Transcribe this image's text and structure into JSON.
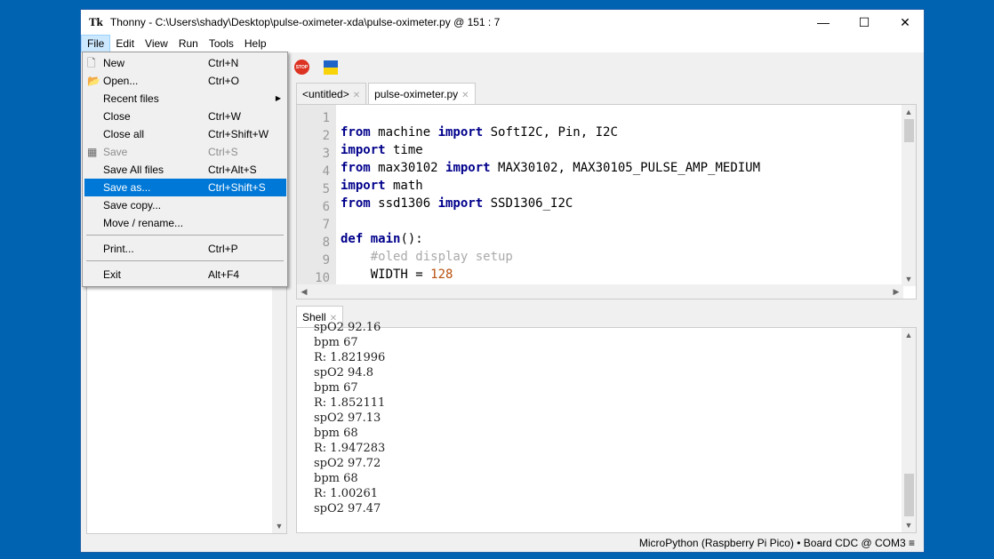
{
  "window": {
    "app_logo": "Tk",
    "title": "Thonny  -  C:\\Users\\shady\\Desktop\\pulse-oximeter-xda\\pulse-oximeter.py  @  151 : 7",
    "minimize": "—",
    "maximize": "☐",
    "close": "✕"
  },
  "menubar": [
    "File",
    "Edit",
    "View",
    "Run",
    "Tools",
    "Help"
  ],
  "file_menu": [
    {
      "label": "New",
      "shortcut": "Ctrl+N",
      "icon": "new-file-icon",
      "state": "normal"
    },
    {
      "label": "Open...",
      "shortcut": "Ctrl+O",
      "icon": "open-folder-icon",
      "state": "normal"
    },
    {
      "label": "Recent files",
      "shortcut": "",
      "submenu": true,
      "state": "normal"
    },
    {
      "label": "Close",
      "shortcut": "Ctrl+W",
      "state": "normal"
    },
    {
      "label": "Close all",
      "shortcut": "Ctrl+Shift+W",
      "state": "normal"
    },
    {
      "label": "Save",
      "shortcut": "Ctrl+S",
      "icon": "save-icon",
      "state": "disabled"
    },
    {
      "label": "Save All files",
      "shortcut": "Ctrl+Alt+S",
      "state": "normal"
    },
    {
      "label": "Save as...",
      "shortcut": "Ctrl+Shift+S",
      "state": "highlighted"
    },
    {
      "label": "Save copy...",
      "shortcut": "",
      "state": "normal"
    },
    {
      "label": "Move / rename...",
      "shortcut": "",
      "state": "normal"
    },
    {
      "label": "Print...",
      "shortcut": "Ctrl+P",
      "state": "normal"
    },
    {
      "label": "Exit",
      "shortcut": "Alt+F4",
      "state": "normal"
    }
  ],
  "toolbar": {
    "stop_label": "STOP"
  },
  "editor": {
    "tabs": [
      {
        "label": "<untitled>",
        "selected": false
      },
      {
        "label": "pulse-oximeter.py",
        "selected": true
      }
    ],
    "lines": [
      "1",
      "2",
      "3",
      "4",
      "5",
      "6",
      "7",
      "8",
      "9",
      "10"
    ]
  },
  "shell": {
    "tab": "Shell",
    "lines": [
      "spO2 92.16",
      "bpm 67",
      "R: 1.821996",
      "spO2 94.8",
      "bpm 67",
      "R: 1.852111",
      "spO2 97.13",
      "bpm 68",
      "R: 1.947283",
      "spO2 97.72",
      "bpm 68",
      "R: 1.00261",
      "spO2 97.47"
    ]
  },
  "status": "MicroPython (Raspberry Pi Pico)  •  Board CDC @ COM3  ≡",
  "colors": {
    "accent": "#0078d7",
    "desktop": "#0063b1",
    "keyword": "#00008b",
    "number": "#b8510d"
  }
}
